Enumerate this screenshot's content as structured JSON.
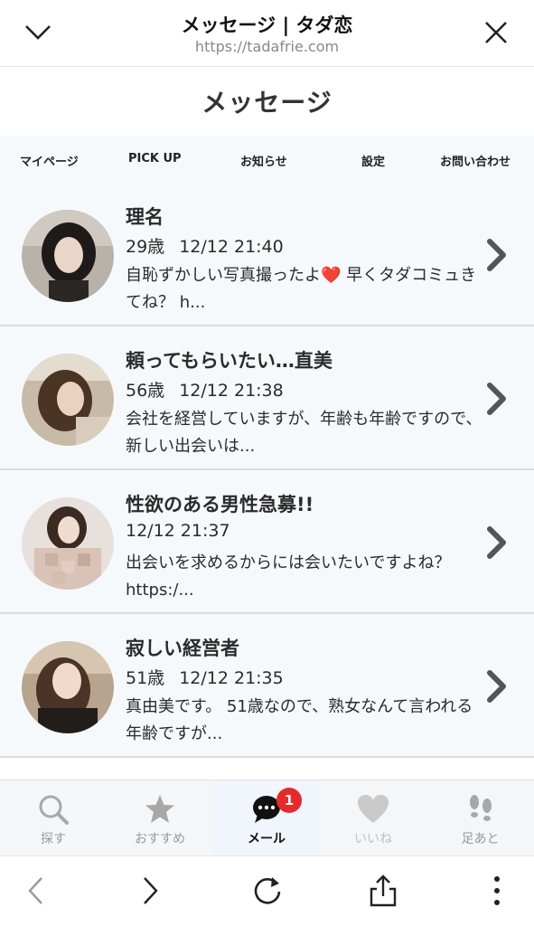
{
  "browser": {
    "title": "メッセージ | タダ恋",
    "url": "https://tadafrie.com"
  },
  "page": {
    "title": "メッセージ"
  },
  "sub_nav": [
    {
      "label": "マイページ"
    },
    {
      "label": "PICK UP"
    },
    {
      "label": "お知らせ"
    },
    {
      "label": "設定"
    },
    {
      "label": "お問い合わせ"
    }
  ],
  "messages": [
    {
      "name": "理名",
      "age": "29歳",
      "date": "12/12 21:40",
      "preview": "自恥ずかしい写真撮ったよ❤️ 早くタダコミュきてね？ h..."
    },
    {
      "name": "頼ってもらいたい…直美",
      "age": "56歳",
      "date": "12/12 21:38",
      "preview": "会社を経営していますが、年齢も年齢ですので、新しい出会いは..."
    },
    {
      "name": "性欲のある男性急募!!",
      "age": "",
      "date": "12/12 21:37",
      "preview": "出会いを求めるからには会いたいですよね？ https:/..."
    },
    {
      "name": "寂しい経営者",
      "age": "51歳",
      "date": "12/12 21:35",
      "preview": "真由美です。 51歳なので、熟女なんて言われる年齢ですが..."
    }
  ],
  "bottom_nav": [
    {
      "label": "探す",
      "icon": "search-icon"
    },
    {
      "label": "おすすめ",
      "icon": "star-icon"
    },
    {
      "label": "メール",
      "icon": "chat-bubble-icon",
      "badge": "1"
    },
    {
      "label": "いいね",
      "icon": "heart-icon"
    },
    {
      "label": "足あと",
      "icon": "footprints-icon"
    }
  ],
  "colors": {
    "badge": "#e8292b",
    "list_bg": "#f6f9fc",
    "active_text": "#111111",
    "inactive_text": "#9a9a9a"
  }
}
